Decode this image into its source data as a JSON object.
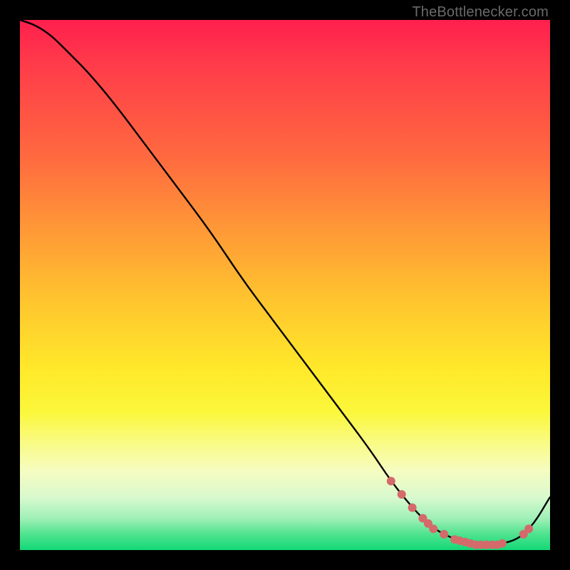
{
  "watermark": "TheBottlenecker.com",
  "colors": {
    "background": "#000000",
    "curve": "#000000",
    "dots": "#d46a6a",
    "watermark": "#6a6a6a"
  },
  "chart_data": {
    "type": "line",
    "title": "",
    "xlabel": "",
    "ylabel": "",
    "xlim": [
      0,
      100
    ],
    "ylim": [
      0,
      100
    ],
    "grid": false,
    "series": [
      {
        "name": "bottleneck-curve",
        "x": [
          0,
          3,
          6,
          9,
          13,
          18,
          24,
          30,
          36,
          42,
          48,
          54,
          60,
          66,
          70,
          74,
          78,
          82,
          86,
          90,
          94,
          97,
          100
        ],
        "values": [
          100,
          99,
          97,
          94,
          90,
          84,
          76,
          68,
          60,
          51,
          43,
          35,
          27,
          19,
          13,
          8,
          4,
          2,
          1,
          1,
          2,
          5,
          10
        ]
      }
    ],
    "annotations": {
      "highlight_dots_x": [
        70,
        72,
        74,
        76,
        77,
        78,
        80,
        82,
        83,
        84,
        85,
        86,
        87,
        88,
        89,
        90,
        91,
        95,
        96
      ]
    }
  }
}
